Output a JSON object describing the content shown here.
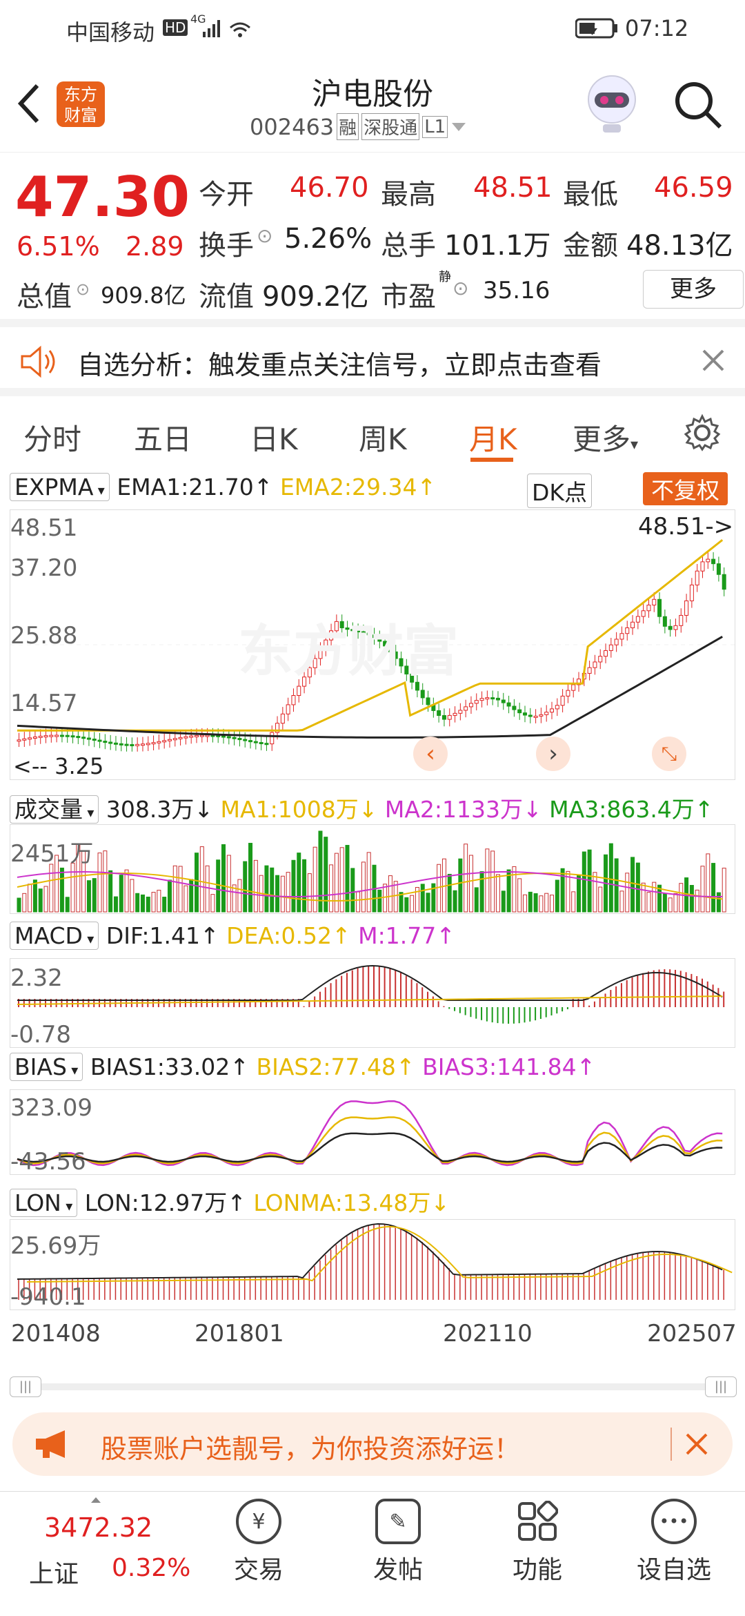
{
  "status": {
    "carrier": "中国移动",
    "hd": "HD",
    "net": "4G",
    "time": "07:12"
  },
  "header": {
    "title": "沪电股份",
    "code": "002463",
    "tags": [
      "融",
      "深股通",
      "L1"
    ],
    "logo_line1": "东方",
    "logo_line2": "财富"
  },
  "quote": {
    "price": "47.30",
    "pct": "6.51%",
    "change": "2.89",
    "open_label": "今开",
    "open": "46.70",
    "high_label": "最高",
    "high": "48.51",
    "low_label": "最低",
    "low": "46.59",
    "turnover_label": "换手",
    "turnover": "5.26%",
    "volume_label": "总手",
    "volume": "101.1万",
    "amount_label": "金额",
    "amount": "48.13亿",
    "mcap_label": "总值",
    "mcap": "909.8亿",
    "float_label": "流值",
    "float": "909.2亿",
    "pe_label": "市盈",
    "pe_sup": "静",
    "pe": "35.16",
    "more_label": "更多"
  },
  "alert": {
    "text": "自选分析：触发重点关注信号，立即点击查看"
  },
  "tabs": [
    {
      "label": "分时"
    },
    {
      "label": "五日"
    },
    {
      "label": "日K"
    },
    {
      "label": "周K"
    },
    {
      "label": "月K"
    },
    {
      "label": "更多"
    }
  ],
  "main_panel": {
    "selector": "EXPMA",
    "ema1": "EMA1:21.70",
    "ema2": "EMA2:29.34",
    "dk": "DK点",
    "fuquan": "不复权",
    "y_labels": [
      "48.51",
      "37.20",
      "25.88",
      "14.57",
      "3.25"
    ],
    "max_marker": "48.51->",
    "min_marker": "<-- 3.25",
    "watermark": "东方财富"
  },
  "volume_panel": {
    "selector": "成交量",
    "current": "308.3万",
    "ma1": "MA1:1008万",
    "ma2": "MA2:1133万",
    "ma3": "MA3:863.4万",
    "y_label": "2451万"
  },
  "macd_panel": {
    "selector": "MACD",
    "dif": "DIF:1.41",
    "dea": "DEA:0.52",
    "m": "M:1.77",
    "y_top": "2.32",
    "y_bottom": "-0.78"
  },
  "bias_panel": {
    "selector": "BIAS",
    "b1": "BIAS1:33.02",
    "b2": "BIAS2:77.48",
    "b3": "BIAS3:141.84",
    "y_top": "323.09",
    "y_bottom": "-43.56"
  },
  "lon_panel": {
    "selector": "LON",
    "lon": "LON:12.97万",
    "lonma": "LONMA:13.48万",
    "y_top": "25.69万",
    "y_bottom": "-940.1"
  },
  "x_axis": [
    "201408",
    "201801",
    "202110",
    "202507"
  ],
  "banner": {
    "text": "股票账户选靓号，为你投资添好运！"
  },
  "bottom": {
    "index_value": "3472.32",
    "index_name": "上证",
    "index_pct": "0.32%",
    "nav": [
      {
        "label": "交易",
        "icon": "yen-icon"
      },
      {
        "label": "发帖",
        "icon": "edit-icon"
      },
      {
        "label": "功能",
        "icon": "grid-icon"
      },
      {
        "label": "设自选",
        "icon": "more-icon"
      }
    ]
  },
  "colors": {
    "up": "#e02020",
    "down": "#1a9a1a",
    "accent": "#e8611b",
    "ema2": "#e6b800",
    "magenta": "#cc33cc"
  }
}
